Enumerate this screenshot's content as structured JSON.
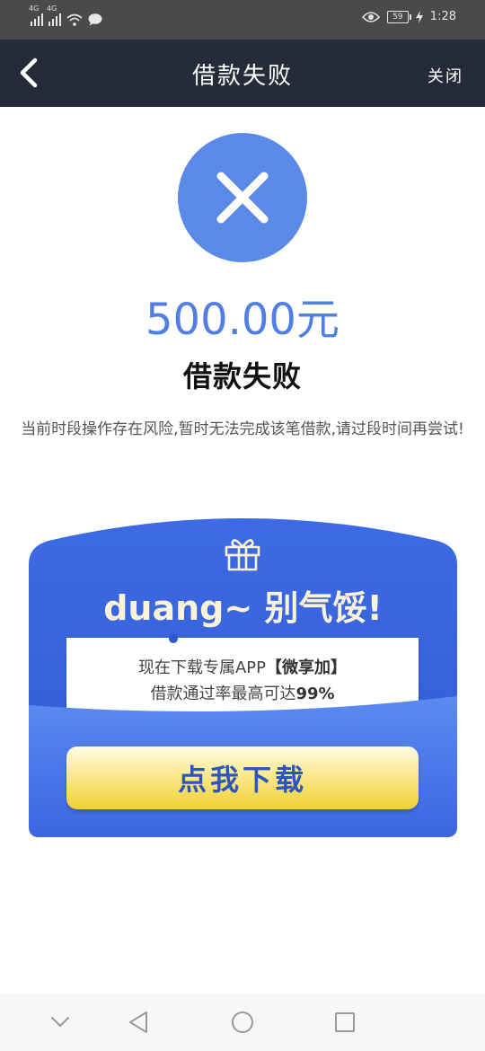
{
  "status_bar": {
    "net1": "4G",
    "net2": "4G",
    "battery": "59",
    "time": "1:28",
    "icons": [
      "signal-icon",
      "signal-icon",
      "wifi-icon",
      "chat-bubble-icon",
      "eye-icon",
      "battery-icon",
      "charging-icon"
    ]
  },
  "header": {
    "title": "借款失败",
    "close_label": "关闭",
    "back_icon": "chevron-left-icon"
  },
  "result": {
    "icon": "close-x-icon",
    "amount": "500.00元",
    "title": "借款失败",
    "message": "当前时段操作存在风险,暂时无法完成该笔借款,请过段时间再尝试!"
  },
  "promo": {
    "icon": "gift-icon",
    "headline": "duang~ 别气馁!",
    "line1_prefix": "现在下载专属APP",
    "line1_app": "【微享加】",
    "line2_prefix": "借款通过率最高可达",
    "line2_rate": "99%",
    "button_label": "点我下载"
  },
  "nav_bar": {
    "icons": [
      "chevron-down-icon",
      "back-triangle-icon",
      "home-circle-icon",
      "recents-square-icon"
    ]
  },
  "colors": {
    "accent": "#4f7fe4",
    "header_bg": "#262b3a",
    "status_bg": "#4a4a4a",
    "promo_blue": "#3f6ee6",
    "button_yellow": "#f6dd55"
  }
}
